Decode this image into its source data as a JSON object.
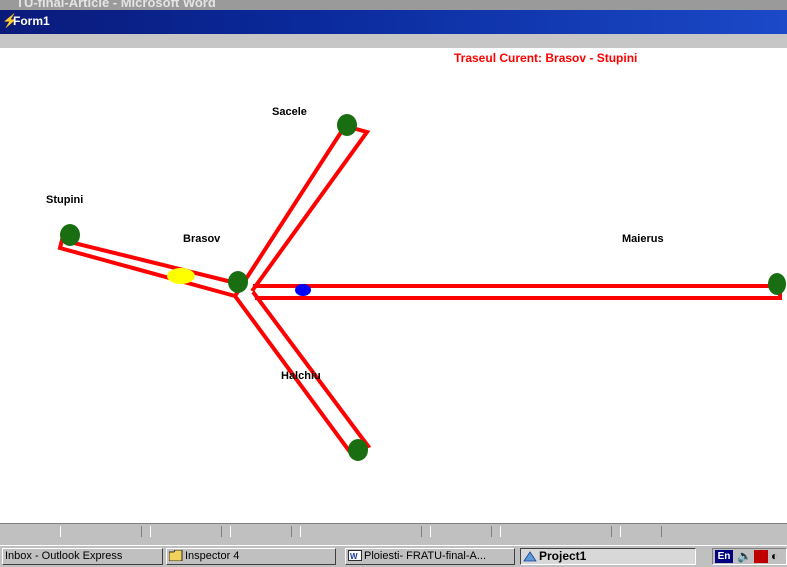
{
  "background_window": {
    "title": "TU-final-Article - Microsoft Word"
  },
  "window": {
    "title": "Form1"
  },
  "map": {
    "route_label": "Traseul Curent: Brasov - Stupini",
    "cities": [
      "Sacele",
      "Stupini",
      "Brasov",
      "Maierus",
      "Halchiu"
    ],
    "colors": {
      "road": "#ff0000",
      "node": "#1a6e12",
      "current_position": "#ffff00",
      "vehicle": "#0000ff",
      "route_label": "#ff0000"
    }
  },
  "taskbar": {
    "buttons": [
      {
        "label": "Inbox - Outlook Express",
        "icon": "outlook-icon"
      },
      {
        "label": "Inspector 4",
        "icon": "folder-icon"
      },
      {
        "label": "Ploiesti- FRATU-final-A...",
        "icon": "word-icon"
      },
      {
        "label": "Project1",
        "icon": "vb-project-icon"
      }
    ],
    "tray": {
      "language": "En",
      "icons": [
        "speaker-icon",
        "network-icon"
      ]
    }
  }
}
